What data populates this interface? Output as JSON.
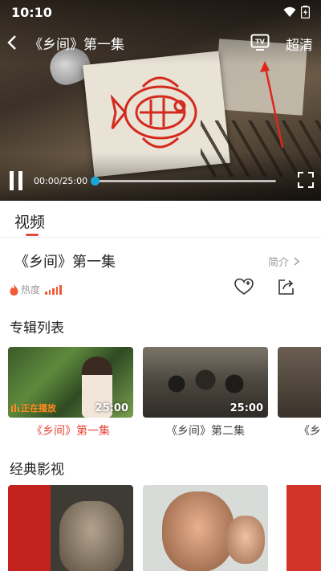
{
  "status_bar": {
    "time": "10:10"
  },
  "player": {
    "title": "《乡间》第一集",
    "quality": "超清",
    "current_time": "00:00",
    "total_time": "/25:00",
    "progress_fraction": 0.0
  },
  "tabs": {
    "video": "视频"
  },
  "episode": {
    "title": "《乡间》第一集",
    "intro_label": "简介",
    "heat_label": "热度"
  },
  "album": {
    "title": "专辑列表",
    "items": [
      {
        "caption": "《乡间》第一集",
        "duration": "25:00",
        "playing_label": "正在播放",
        "active": true
      },
      {
        "caption": "《乡间》第二集",
        "duration": "25:00",
        "active": false
      },
      {
        "caption": "《乡",
        "duration": "",
        "active": false
      }
    ]
  },
  "classics": {
    "title": "经典影视"
  },
  "colors": {
    "accent": "#e8463a",
    "progress": "#1aa7d8"
  },
  "icons": [
    "back-icon",
    "tv-cast-icon",
    "pause-icon",
    "fullscreen-icon",
    "chevron-right-icon",
    "flame-icon",
    "heart-plus-icon",
    "share-icon",
    "wifi-icon",
    "battery-icon"
  ]
}
